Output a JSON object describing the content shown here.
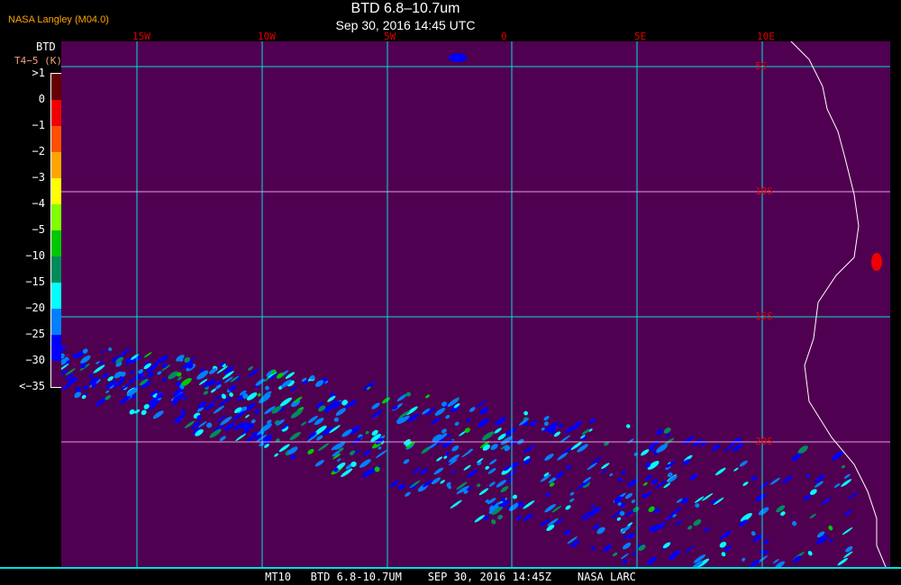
{
  "header": {
    "title": "BTD 6.8–10.7um",
    "subtitle": "Sep 30, 2016 14:45 UTC",
    "brand": "NASA Langley (M04.0)"
  },
  "colorbar": {
    "title": "BTD",
    "unit": "T4−5 (K)",
    "labels": [
      ">1",
      "0",
      "−1",
      "−2",
      "−3",
      "−4",
      "−5",
      "−10",
      "−15",
      "−20",
      "−25",
      "−30",
      "<−35"
    ],
    "colors": [
      "#640000",
      "#f00000",
      "#ff5000",
      "#ffa500",
      "#ffff00",
      "#80ff00",
      "#00c800",
      "#008c5a",
      "#00ffff",
      "#0080ff",
      "#0000ff",
      "#500050"
    ]
  },
  "map": {
    "lon_labels": [
      "15W",
      "10W",
      "5W",
      "0",
      "5E",
      "10E"
    ],
    "lat_labels": [
      "5S",
      "10S",
      "15S",
      "20S"
    ]
  },
  "footer": "MT10   BTD 6.8-10.7UM    SEP 30, 2016 14:45Z    NASA LARC"
}
